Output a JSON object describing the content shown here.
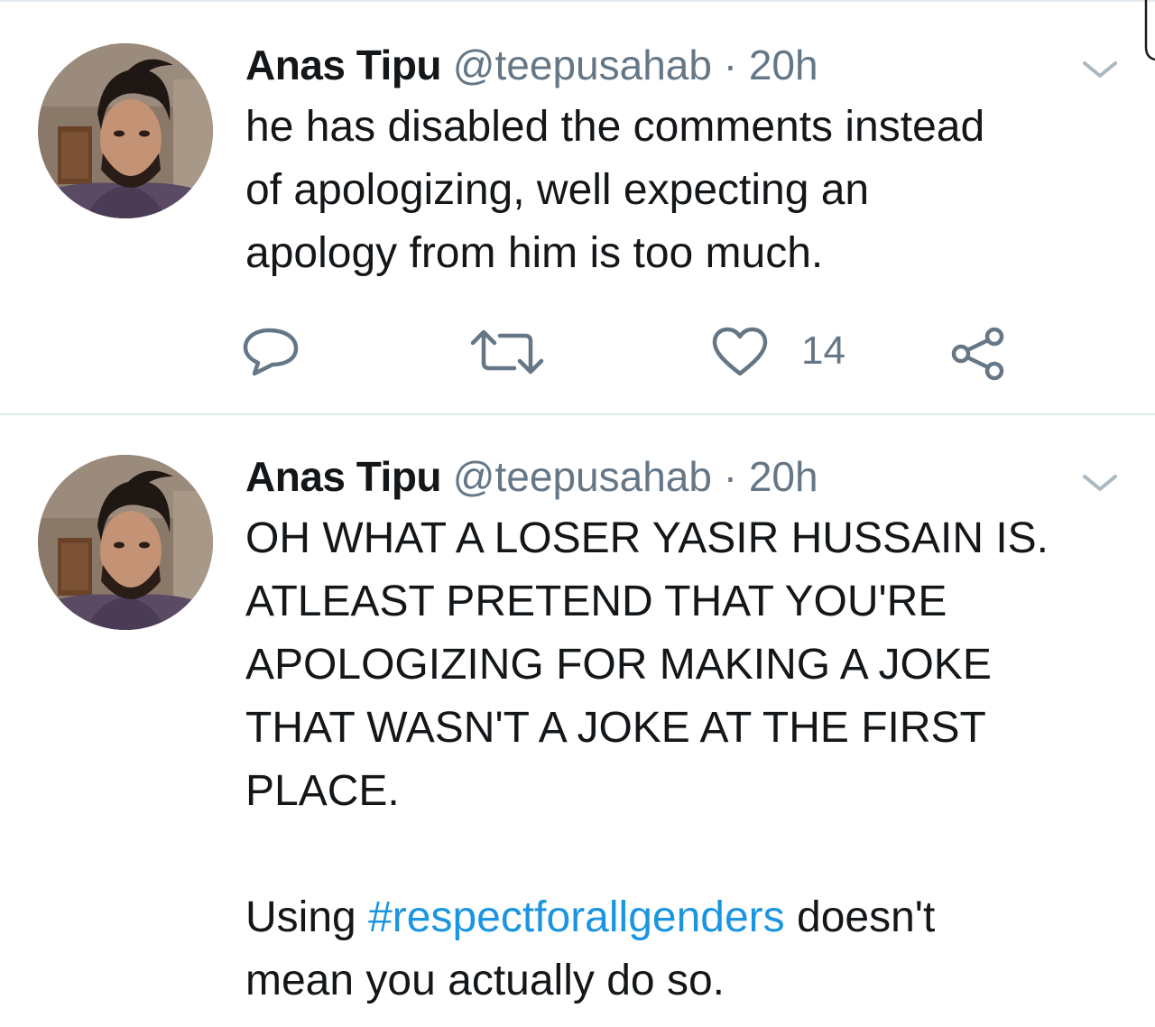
{
  "tweets": [
    {
      "name": "Anas Tipu",
      "handle": "@teepusahab",
      "separator": "·",
      "time": "20h",
      "lines": [
        "he has disabled the comments instead",
        "of apologizing, well expecting an",
        "apology from him is too much."
      ],
      "like_count": "14"
    },
    {
      "name": "Anas Tipu",
      "handle": "@teepusahab",
      "separator": "·",
      "time": "20h",
      "lines": [
        "OH WHAT A LOSER YASIR HUSSAIN IS.",
        "ATLEAST PRETEND THAT YOU'RE",
        "APOLOGIZING FOR MAKING A JOKE",
        "THAT WASN'T A JOKE AT THE FIRST",
        "PLACE."
      ],
      "final_prefix": "Using ",
      "hashtag": "#respectforallgenders",
      "final_suffix": " doesn't",
      "final_line": "mean you actually do so."
    }
  ],
  "icons": {
    "reply": "reply-icon",
    "retweet": "retweet-icon",
    "like": "heart-icon",
    "share": "share-icon",
    "menu": "chevron-down-icon"
  },
  "colors": {
    "text": "#14171a",
    "secondary": "#657786",
    "link": "#1b95e0",
    "divider": "#e1e8ed"
  }
}
